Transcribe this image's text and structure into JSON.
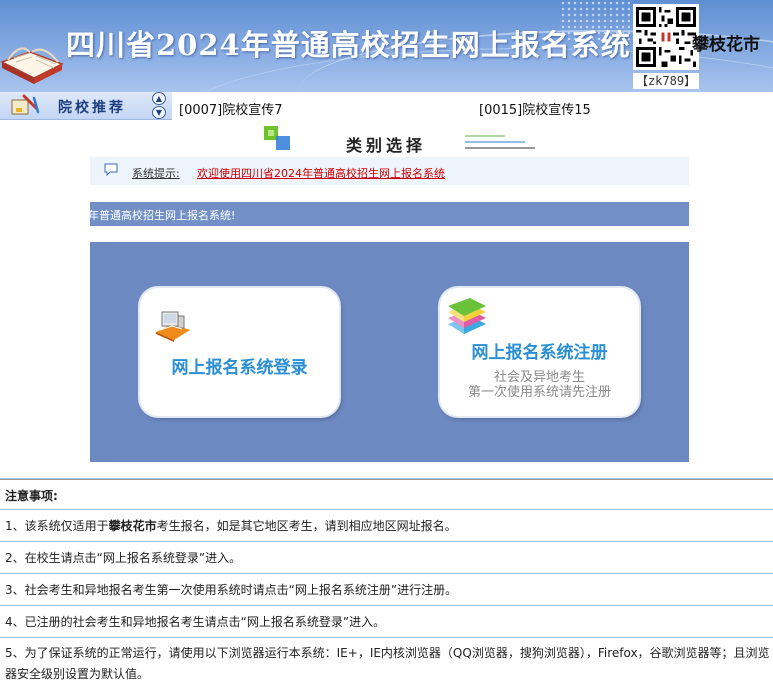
{
  "header": {
    "title": "四川省2024年普通高校招生网上报名系统",
    "qr_code_label": "【zk789】",
    "city": "攀枝花市"
  },
  "recommend": {
    "label": "院校推荐",
    "links": [
      "[0007]院校宣传7",
      "[0015]院校宣传15"
    ]
  },
  "category": {
    "title": "类别选择"
  },
  "notice": {
    "label": "系统提示:",
    "message": "欢迎使用四川省2024年普通高校招生网上报名系统"
  },
  "marquee": {
    "text": "年普通高校招生网上报名系统!"
  },
  "cards": {
    "login": {
      "title": "网上报名系统登录"
    },
    "register": {
      "title": "网上报名系统注册",
      "sub_line1": "社会及异地考生",
      "sub_line2": "第一次使用系统请先注册"
    }
  },
  "notes": {
    "heading": "注意事项:",
    "item1_prefix": "1、该系统仅适用于",
    "item1_city": "攀枝花市",
    "item1_suffix": "考生报名，如是其它地区考生，请到相应地区网址报名。",
    "item2": "2、在校生请点击“网上报名系统登录”进入。",
    "item3": "3、社会考生和异地报名考生第一次使用系统时请点击“网上报名系统注册”进行注册。",
    "item4": "4、已注册的社会考生和异地报名考生请点击“网上报名系统登录”进入。",
    "item5": "5、为了保证系统的正常运行，请使用以下浏览器运行本系统：IE+，IE内核浏览器（QQ浏览器，搜狗浏览器），Firefox，谷歌浏览器等；且浏览器安全级别设置为默认值。"
  },
  "colors": {
    "header_blue": "#5f8fd3",
    "panel_blue": "#6d89c2",
    "card_title_blue": "#2a8fd4",
    "notice_red": "#cc0000"
  },
  "icons": [
    "book-icon",
    "qr-code-icon",
    "recommend-icon",
    "scroll-up-icon",
    "scroll-down-icon",
    "cube-icon",
    "speech-bubble-icon",
    "computer-icon",
    "books-icon"
  ]
}
